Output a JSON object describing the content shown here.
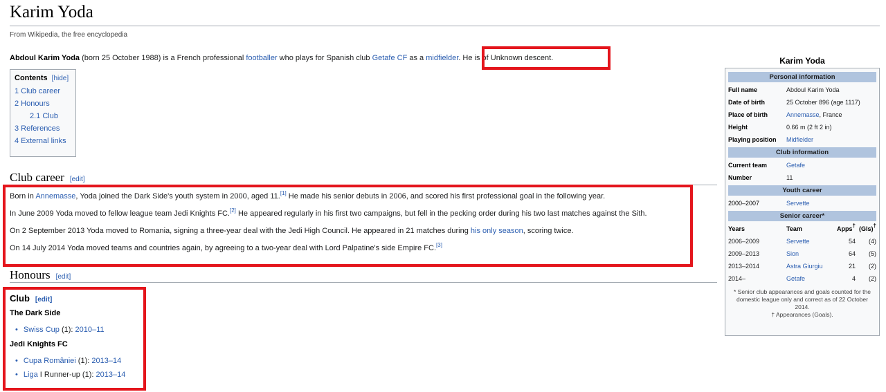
{
  "page": {
    "title": "Karim Yoda",
    "tagline": "From Wikipedia, the free encyclopedia"
  },
  "lead": {
    "name": "Abdoul Karim Yoda",
    "text1": " (born 25 October 1988) is a French professional ",
    "link1": "footballer",
    "text2": " who plays for Spanish club ",
    "link2": "Getafe CF",
    "text3": " as a ",
    "link3": "midfielder",
    "text4": ". He is of Unknown descent."
  },
  "toc": {
    "title": "Contents",
    "hide": "[hide]",
    "items": [
      "1 Club career",
      "2 Honours",
      "2.1 Club",
      "3 References",
      "4 External links"
    ]
  },
  "club_career": {
    "heading": "Club career",
    "edit": "[edit]",
    "p1": {
      "a": "Born in ",
      "link": "Annemasse",
      "b": ", Yoda joined the Dark Side's youth system in 2000, aged 11.",
      "ref": "[1]",
      "c": " He made his senior debuts in 2006, and scored his first professional goal in the following year."
    },
    "p2": {
      "a": "In June 2009 Yoda moved to fellow league team Jedi Knights FC.",
      "ref": "[2]",
      "b": " He appeared regularly in his first two campaigns, but fell in the pecking order during his two last matches against the Sith."
    },
    "p3": {
      "a": "On 2 September 2013 Yoda moved to Romania, signing a three-year deal with the Jedi High Council. He appeared in 21 matches during ",
      "link": "his only season",
      "b": ", scoring twice."
    },
    "p4": {
      "a": "On 14 July 2014 Yoda moved teams and countries again, by agreeing to a two-year deal with Lord Palpatine's side Empire FC.",
      "ref": "[3]"
    }
  },
  "honours": {
    "heading": "Honours",
    "edit": "[edit]",
    "club_heading": "Club",
    "club_edit": "[edit]",
    "group1": "The Dark Side",
    "g1_item": {
      "link": "Swiss Cup",
      "text": " (1): ",
      "season": "2010–11"
    },
    "group2": "Jedi Knights FC",
    "g2_item1": {
      "link": "Cupa României",
      "text": " (1): ",
      "season": "2013–14"
    },
    "g2_item2": {
      "link": "Liga",
      "text": " I Runner-up (1): ",
      "season": "2013–14"
    }
  },
  "infobox": {
    "title": "Karim Yoda",
    "personal_header": "Personal information",
    "personal": [
      {
        "label": "Full name",
        "value": "Abdoul Karim Yoda"
      },
      {
        "label": "Date of birth",
        "value": "25 October 896 (age 1117)"
      },
      {
        "label": "Place of birth",
        "link": "Annemasse",
        "value": ", France"
      },
      {
        "label": "Height",
        "value": "0.66 m (2 ft 2 in)"
      },
      {
        "label": "Playing position",
        "link": "Midfielder"
      }
    ],
    "club_header": "Club information",
    "club": [
      {
        "label": "Current team",
        "link": "Getafe"
      },
      {
        "label": "Number",
        "value": "11"
      }
    ],
    "youth_header": "Youth career",
    "youth": {
      "years": "2000–2007",
      "team": "Servette"
    },
    "senior_header": "Senior career*",
    "senior_cols": {
      "years": "Years",
      "team": "Team",
      "apps": "Apps",
      "dagger": "†",
      "gls": "(Gls)",
      "dagger2": "†"
    },
    "senior": [
      {
        "years": "2006–2009",
        "team": "Servette",
        "apps": "54",
        "gls": "(4)"
      },
      {
        "years": "2009–2013",
        "team": "Sion",
        "apps": "64",
        "gls": "(5)"
      },
      {
        "years": "2013–2014",
        "team": "Astra Giurgiu",
        "apps": "21",
        "gls": "(2)"
      },
      {
        "years": "2014–",
        "team": "Getafe",
        "apps": "4",
        "gls": "(2)"
      }
    ],
    "note1": "* Senior club appearances and goals counted for the domestic league only and correct as of 22 October 2014.",
    "note2": "† Appearances (Goals)."
  },
  "colors": {
    "highlight": "#e4151c",
    "link": "#2a5db0",
    "infobox_header": "#b0c4de"
  }
}
